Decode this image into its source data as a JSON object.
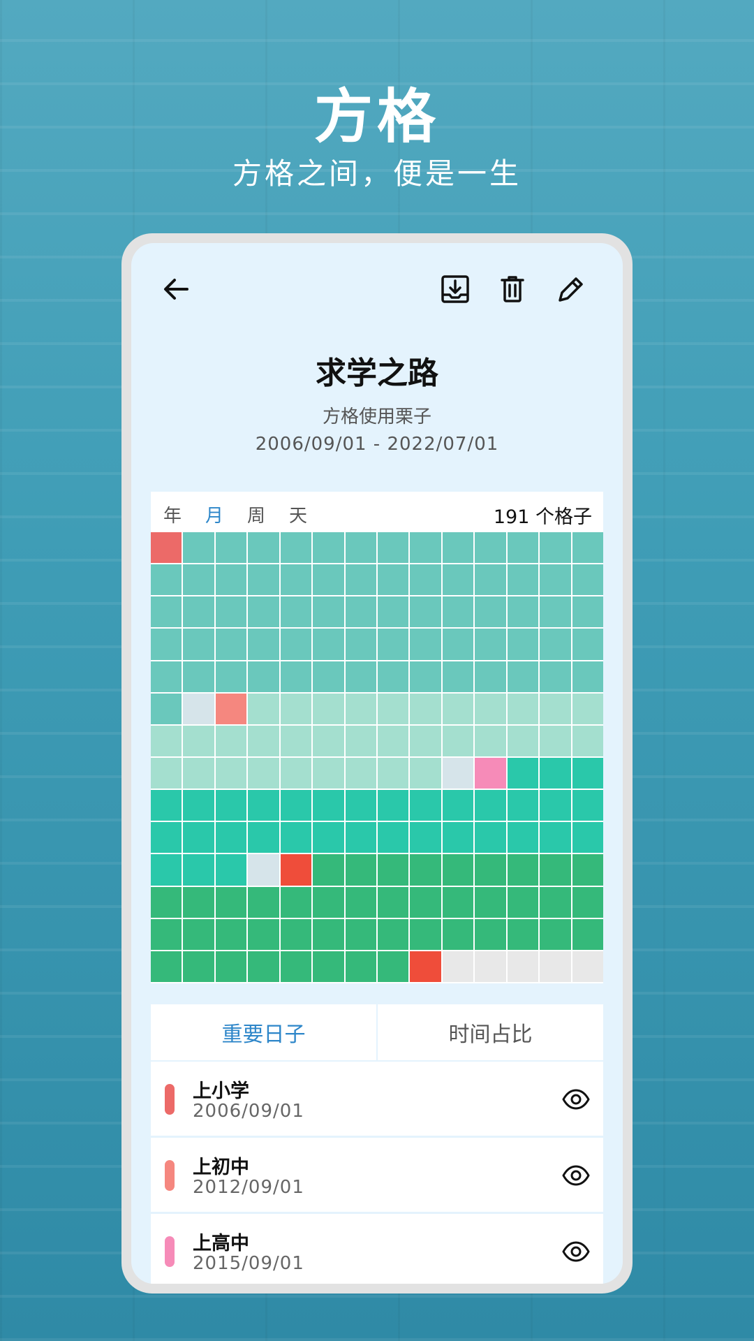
{
  "hero": {
    "title": "方格",
    "subtitle": "方格之间，便是一生"
  },
  "project": {
    "title": "求学之路",
    "subtitle": "方格使用栗子",
    "dates": "2006/09/01 - 2022/07/01"
  },
  "grid": {
    "unit_tabs": [
      "年",
      "月",
      "周",
      "天"
    ],
    "active_unit": 1,
    "count_label": "191 个格子",
    "columns": 14,
    "rows": 14,
    "palette": {
      "A": "#6ac8bc",
      "B": "#a4dfcf",
      "C": "#2ac8aa",
      "D": "#35b97a",
      "E": "#e8e8e8",
      "F": "#d6e4ea",
      "r1": "#ec6a68",
      "r2": "#f5877f",
      "p": "#f68bb8",
      "r3": "#ef4d3a",
      "r4": "#ef4d3a"
    },
    "cells": [
      "r1",
      "A",
      "A",
      "A",
      "A",
      "A",
      "A",
      "A",
      "A",
      "A",
      "A",
      "A",
      "A",
      "A",
      "A",
      "A",
      "A",
      "A",
      "A",
      "A",
      "A",
      "A",
      "A",
      "A",
      "A",
      "A",
      "A",
      "A",
      "A",
      "A",
      "A",
      "A",
      "A",
      "A",
      "A",
      "A",
      "A",
      "A",
      "A",
      "A",
      "A",
      "A",
      "A",
      "A",
      "A",
      "A",
      "A",
      "A",
      "A",
      "A",
      "A",
      "A",
      "A",
      "A",
      "A",
      "A",
      "A",
      "A",
      "A",
      "A",
      "A",
      "A",
      "A",
      "A",
      "A",
      "A",
      "A",
      "A",
      "A",
      "A",
      "A",
      "F",
      "r2",
      "B",
      "B",
      "B",
      "B",
      "B",
      "B",
      "B",
      "B",
      "B",
      "B",
      "B",
      "B",
      "B",
      "B",
      "B",
      "B",
      "B",
      "B",
      "B",
      "B",
      "B",
      "B",
      "B",
      "B",
      "B",
      "B",
      "B",
      "B",
      "B",
      "B",
      "B",
      "B",
      "B",
      "B",
      "F",
      "p",
      "C",
      "C",
      "C",
      "C",
      "C",
      "C",
      "C",
      "C",
      "C",
      "C",
      "C",
      "C",
      "C",
      "C",
      "C",
      "C",
      "C",
      "C",
      "C",
      "C",
      "C",
      "C",
      "C",
      "C",
      "C",
      "C",
      "C",
      "C",
      "C",
      "C",
      "C",
      "C",
      "C",
      "C",
      "F",
      "r3",
      "D",
      "D",
      "D",
      "D",
      "D",
      "D",
      "D",
      "D",
      "D",
      "D",
      "D",
      "D",
      "D",
      "D",
      "D",
      "D",
      "D",
      "D",
      "D",
      "D",
      "D",
      "D",
      "D",
      "D",
      "D",
      "D",
      "D",
      "D",
      "D",
      "D",
      "D",
      "D",
      "D",
      "D",
      "D",
      "D",
      "D",
      "D",
      "D",
      "D",
      "D",
      "D",
      "D",
      "D",
      "D",
      "r4",
      "E",
      "E",
      "E",
      "E",
      "E"
    ]
  },
  "segments": {
    "important_days": "重要日子",
    "time_ratio": "时间占比"
  },
  "events": [
    {
      "name": "上小学",
      "date": "2006/09/01",
      "color": "#ec6a68"
    },
    {
      "name": "上初中",
      "date": "2012/09/01",
      "color": "#f5877f"
    },
    {
      "name": "上高中",
      "date": "2015/09/01",
      "color": "#f68bb8"
    }
  ],
  "icons": {
    "back": "arrow-left-icon",
    "download": "download-tray-icon",
    "delete": "trash-icon",
    "edit": "pencil-icon",
    "visibility": "eye-icon"
  }
}
